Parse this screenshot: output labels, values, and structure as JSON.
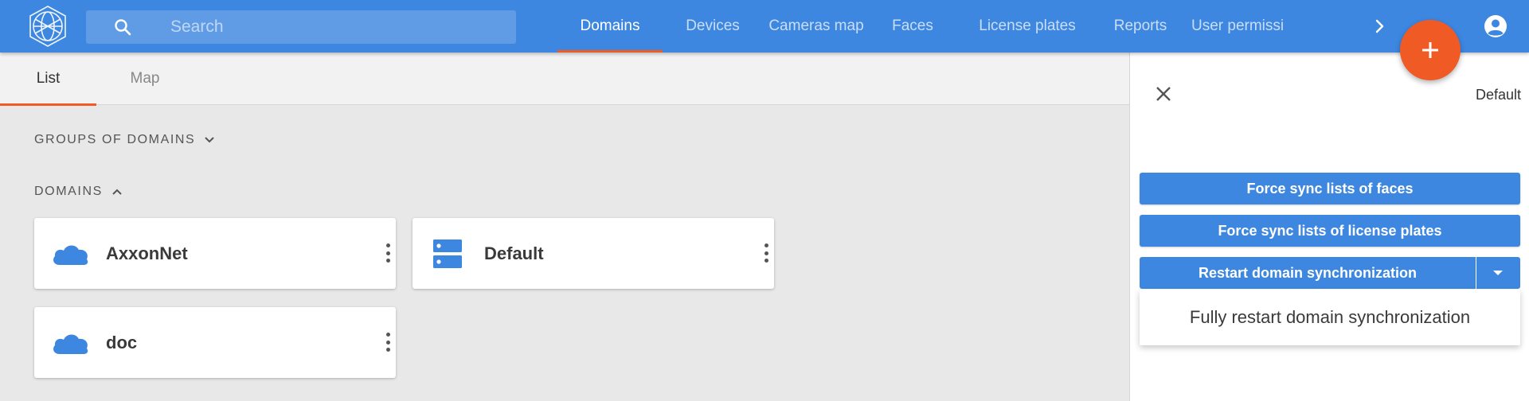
{
  "header": {
    "logo_icon": "network-sphere-logo",
    "search": {
      "placeholder": "Search",
      "value": "",
      "icon": "search-icon"
    },
    "nav": [
      {
        "label": "Domains",
        "active": true
      },
      {
        "label": "Devices",
        "active": false
      },
      {
        "label": "Cameras map",
        "active": false
      },
      {
        "label": "Faces",
        "active": false
      },
      {
        "label": "License plates",
        "active": false
      },
      {
        "label": "Reports",
        "active": false
      },
      {
        "label": "User permissi",
        "active": false
      }
    ],
    "nav_more_icon": "chevron-right-icon",
    "account_icon": "account-circle-icon",
    "fab_icon": "plus-icon"
  },
  "subtabs": [
    {
      "label": "List",
      "active": true
    },
    {
      "label": "Map",
      "active": false
    }
  ],
  "main": {
    "groups_header": "GROUPS OF DOMAINS",
    "domains_header": "DOMAINS",
    "cards": [
      {
        "label": "AxxonNet",
        "icon": "cloud-icon"
      },
      {
        "label": "Default",
        "icon": "server-icon"
      },
      {
        "label": "doc",
        "icon": "cloud-icon"
      }
    ]
  },
  "panel": {
    "title": "Default",
    "buttons": {
      "sync_faces": "Force sync lists of faces",
      "sync_plates": "Force sync lists of license plates",
      "restart_sync": "Restart domain synchronization"
    },
    "dropdown_item": "Fully restart domain synchronization"
  },
  "colors": {
    "primary": "#3d87e0",
    "accent": "#f05a24",
    "background": "#e8e8e8"
  }
}
